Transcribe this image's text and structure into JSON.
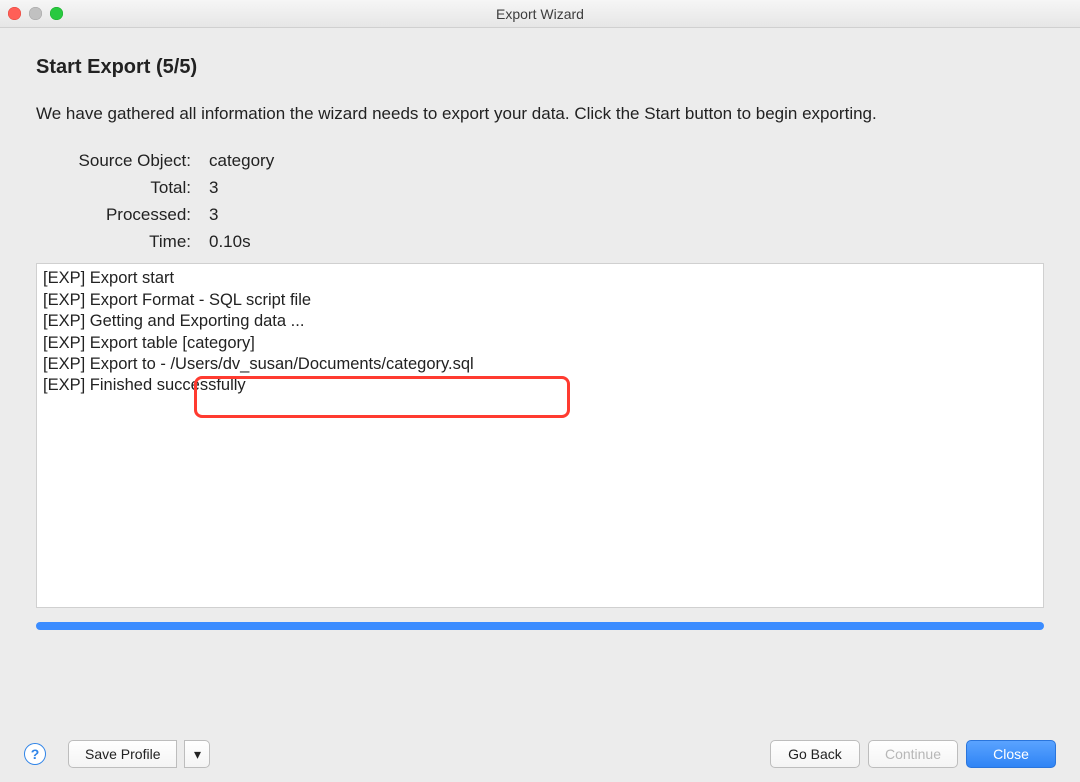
{
  "window": {
    "title": "Export Wizard"
  },
  "page": {
    "heading": "Start Export (5/5)",
    "description": "We have gathered all information the wizard needs to export your data. Click the Start button to begin exporting."
  },
  "summary": {
    "source_object_label": "Source Object:",
    "source_object_value": "category",
    "total_label": "Total:",
    "total_value": "3",
    "processed_label": "Processed:",
    "processed_value": "3",
    "time_label": "Time:",
    "time_value": "0.10s"
  },
  "log": {
    "lines": [
      "[EXP] Export start",
      "[EXP] Export Format - SQL script file",
      "[EXP] Getting and Exporting data ...",
      "[EXP] Export table [category]",
      "[EXP] Export to - /Users/dv_susan/Documents/category.sql",
      "[EXP] Finished successfully"
    ],
    "highlighted_path": "/Users/dv_susan/Documents/category.sql"
  },
  "progress": {
    "percent": 100
  },
  "footer": {
    "help_glyph": "?",
    "save_profile": "Save Profile",
    "dropdown_glyph": "▾",
    "go_back": "Go Back",
    "continue": "Continue",
    "close": "Close"
  }
}
